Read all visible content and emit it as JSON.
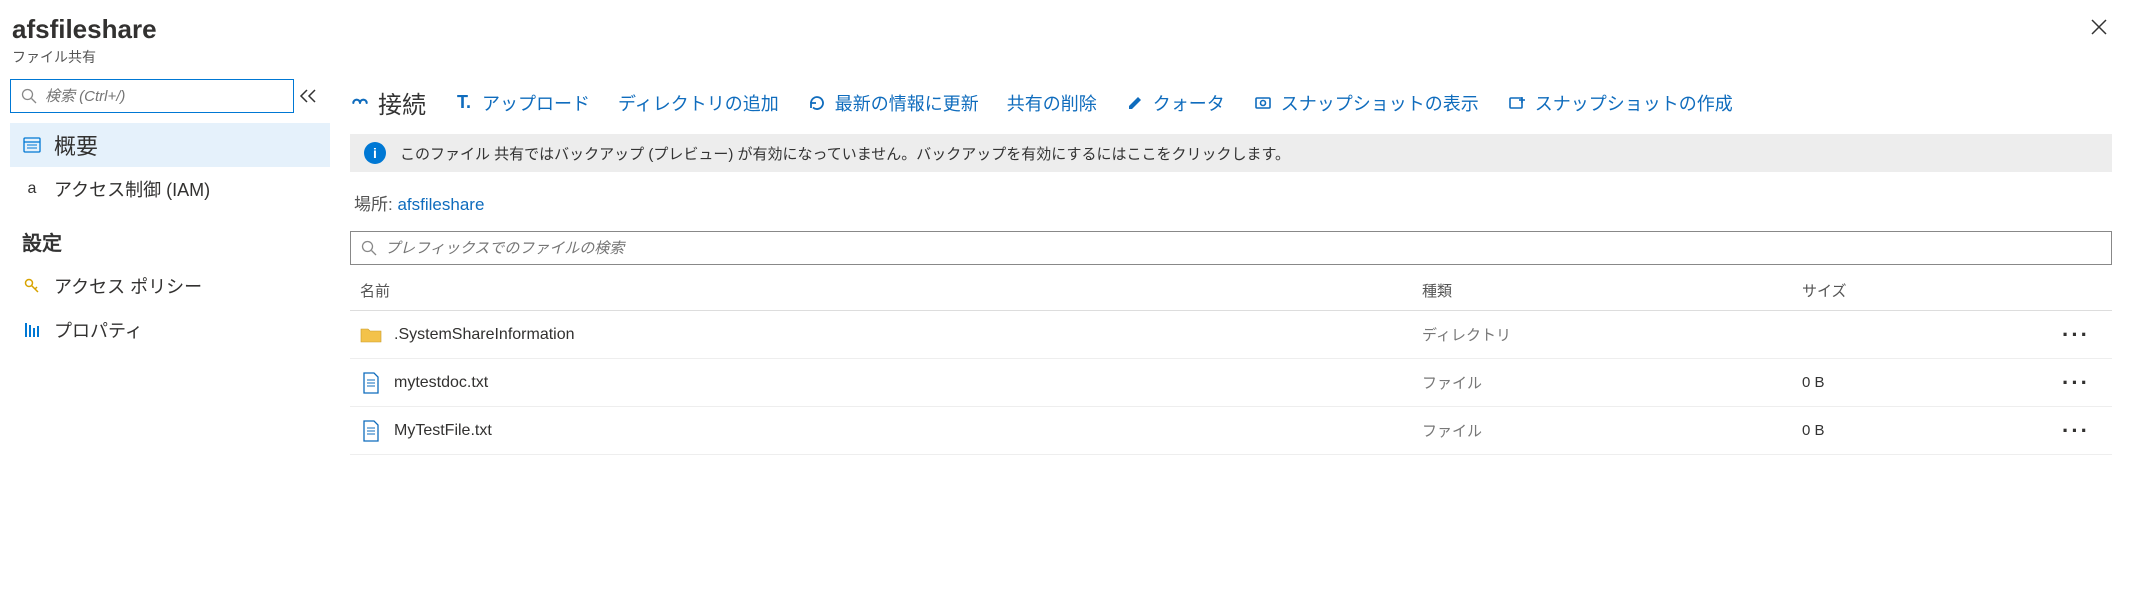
{
  "header": {
    "title": "afsfileshare",
    "subtitle": "ファイル共有"
  },
  "sidebar": {
    "search_placeholder": "検索 (Ctrl+/)",
    "items": {
      "overview": "概要",
      "iam_prefix": "a",
      "iam": "アクセス制御 (IAM)"
    },
    "group_settings": "設定",
    "settings_items": {
      "access_policy": "アクセス ポリシー",
      "properties": "プロパティ"
    }
  },
  "toolbar": {
    "connect": "接続",
    "upload_prefix": "T.",
    "upload": "アップロード",
    "add_dir": "ディレクトリの追加",
    "refresh": "最新の情報に更新",
    "delete": "共有の削除",
    "quota": "クォータ",
    "view_snapshot": "スナップショットの表示",
    "create_snapshot": "スナップショットの作成"
  },
  "info_bar": {
    "text": "このファイル 共有ではバックアップ (プレビュー) が有効になっていません。バックアップを有効にするにはここをクリックします。"
  },
  "location": {
    "label": "場所:",
    "value": "afsfileshare"
  },
  "file_search": {
    "placeholder": "プレフィックスでのファイルの検索"
  },
  "grid": {
    "columns": {
      "name": "名前",
      "type": "種類",
      "size": "サイズ"
    },
    "rows": [
      {
        "name": ".SystemShareInformation",
        "type": "ディレクトリ",
        "size": ""
      },
      {
        "name": "mytestdoc.txt",
        "type": "ファイル",
        "size": "0 B"
      },
      {
        "name": "MyTestFile.txt",
        "type": "ファイル",
        "size": "0 B"
      }
    ]
  }
}
